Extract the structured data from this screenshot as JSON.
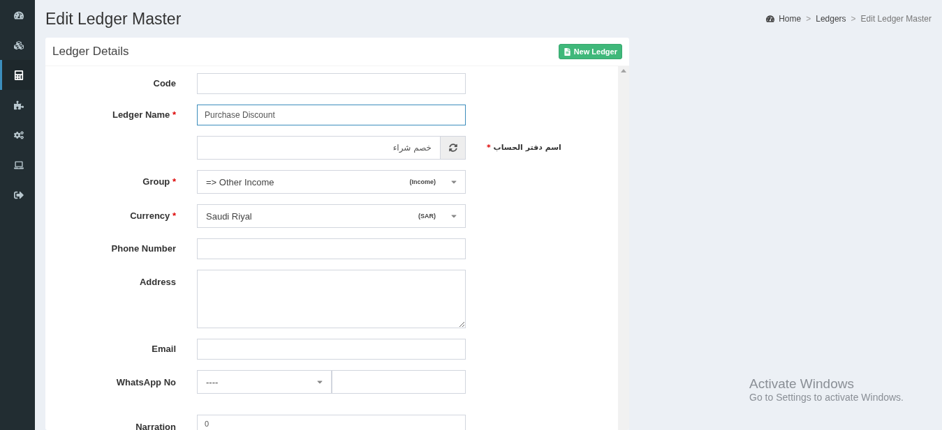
{
  "sidebar": {
    "items": [
      {
        "selected": false
      },
      {
        "selected": false
      },
      {
        "selected": true
      },
      {
        "selected": false
      },
      {
        "selected": false
      },
      {
        "selected": false
      },
      {
        "selected": false
      }
    ]
  },
  "page_title": "Edit Ledger Master",
  "breadcrumb": [
    {
      "label": "Home",
      "kind": "home"
    },
    {
      "separator": ">",
      "label": "Ledgers",
      "kind": "link"
    },
    {
      "separator": ">",
      "label": "Edit Ledger Master",
      "kind": "current"
    }
  ],
  "card": {
    "title": "Ledger Details",
    "new_button": "New Ledger",
    "fields": [
      {
        "kind": "text",
        "label": "Code",
        "focused": false
      },
      {
        "kind": "text",
        "label": "Ledger Name",
        "required_mark": "*",
        "value": "Purchase Discount",
        "focused": true
      },
      {
        "kind": "arabic",
        "label": "اسم دفتر الحساب",
        "required_mark": "*",
        "value": "خصم شراء",
        "focused": false
      },
      {
        "kind": "select",
        "label": "Group",
        "required_mark": "*",
        "value": "=> Other Income",
        "tag": "(Income)",
        "focused": false
      },
      {
        "kind": "select",
        "label": "Currency",
        "required_mark": "*",
        "value": "Saudi Riyal",
        "tag": "(SAR)",
        "focused": false
      },
      {
        "kind": "text",
        "label": "Phone Number",
        "focused": false
      },
      {
        "kind": "textarea",
        "label": "Address",
        "focused": false
      },
      {
        "kind": "text",
        "label": "Email",
        "focused": false
      },
      {
        "kind": "phone",
        "label": "WhatsApp No",
        "code": "----",
        "focused": false
      },
      {
        "kind": "narration",
        "label": "Narration",
        "value": "0",
        "focused": false
      }
    ]
  },
  "os_notice": {
    "title": "Activate Windows",
    "subtitle": "Go to Settings to activate Windows."
  }
}
